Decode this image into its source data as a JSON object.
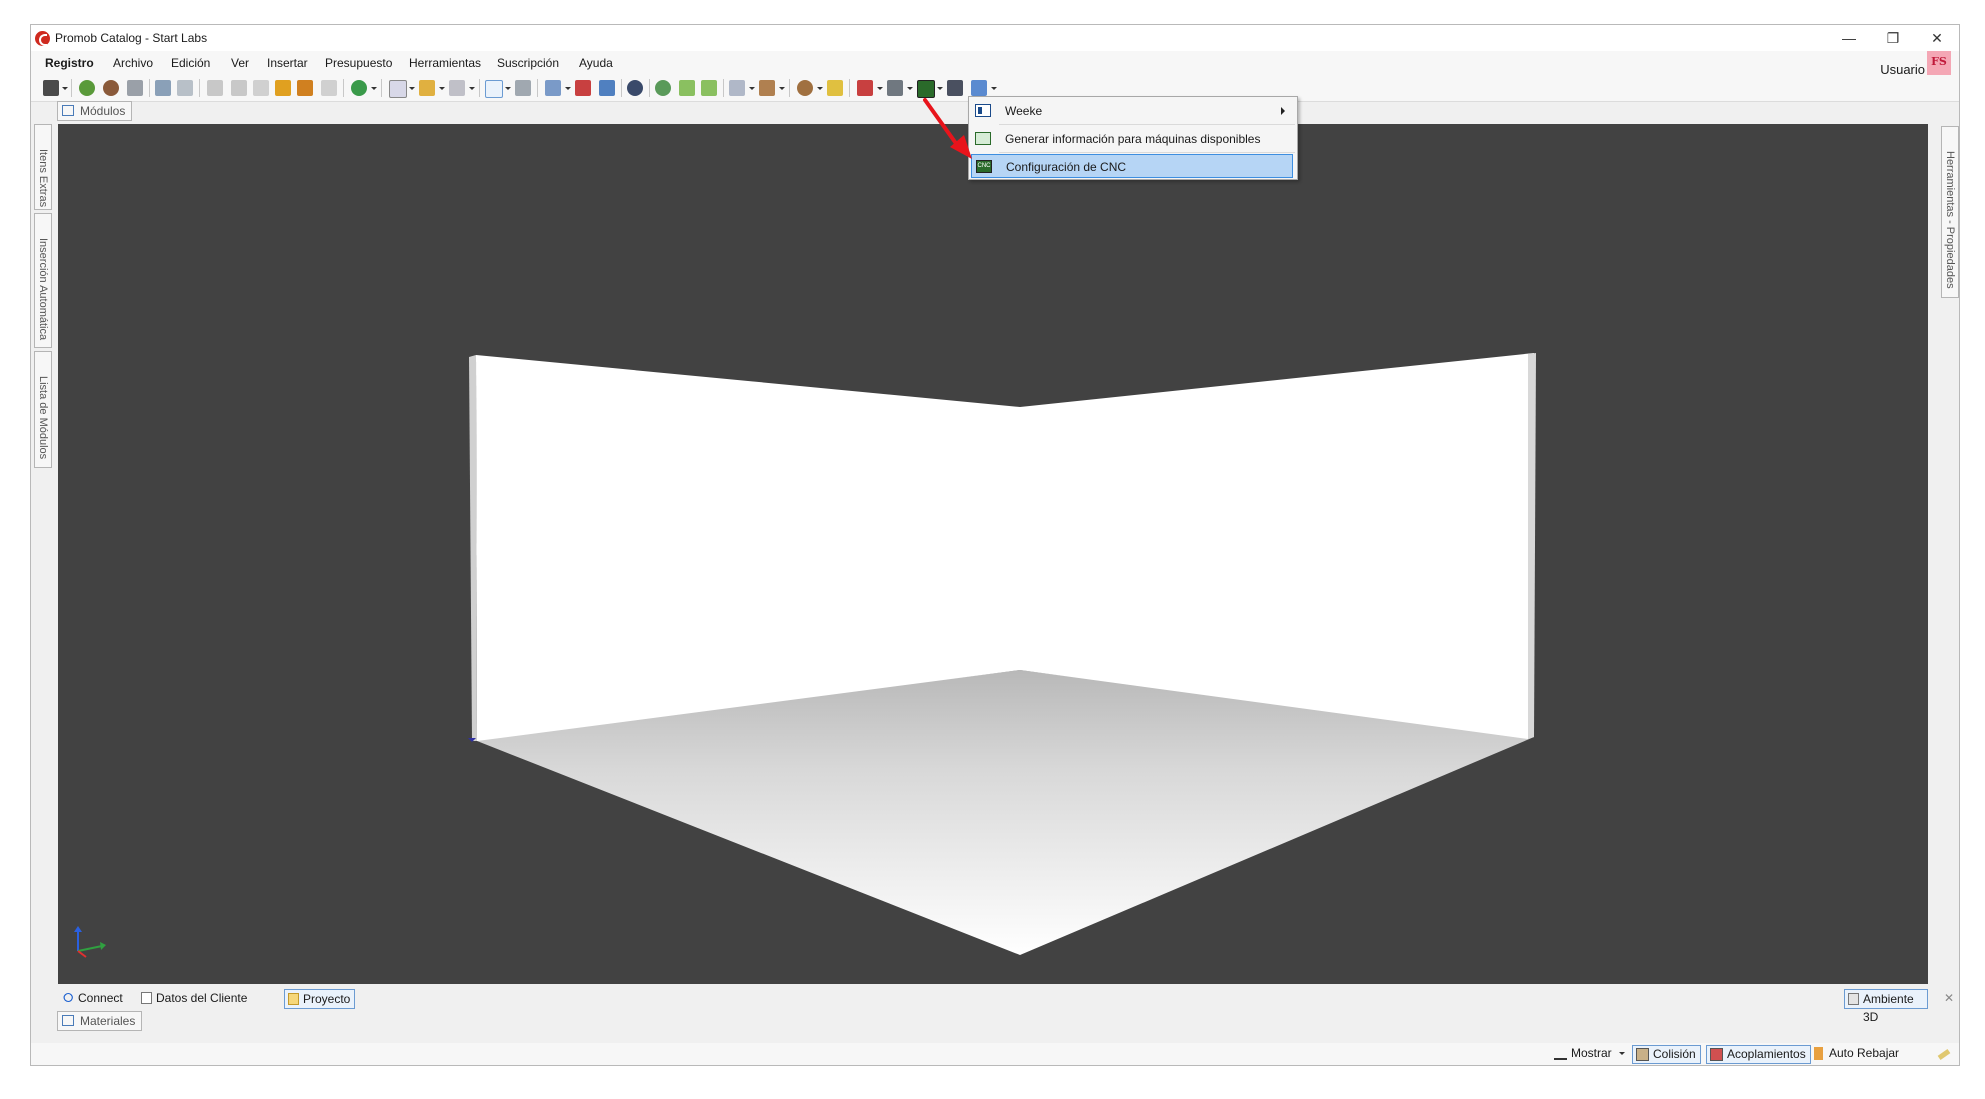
{
  "window": {
    "title": "Promob Catalog - Start Labs",
    "controls": {
      "minimize": "—",
      "restore": "❐",
      "close": "✕"
    }
  },
  "menu": [
    "Registro",
    "Archivo",
    "Edición",
    "Ver",
    "Insertar",
    "Presupuesto",
    "Herramientas",
    "Suscripción",
    "Ayuda"
  ],
  "user": {
    "label": "Usuario",
    "badge": "FS"
  },
  "panels": {
    "top_tab": "Módulos",
    "bottom_tab": "Materiales",
    "left_tabs": [
      "Itens Extras",
      "Inserción Automática",
      "Lista de Módulos"
    ],
    "right_tabs": [
      "Herramientas - Propiedades"
    ]
  },
  "dropdown": {
    "items": [
      {
        "label": "Weeke",
        "icon": "weeke-machine-icon",
        "submenu": true
      },
      {
        "label": "Generar información para máquinas disponibles",
        "icon": "machine-info-icon",
        "submenu": false
      },
      {
        "label": "Configuración de CNC",
        "icon": "cnc-config-icon",
        "submenu": false,
        "highlighted": true
      }
    ]
  },
  "bottom_tabs": [
    {
      "label": "Connect",
      "icon": "rss-icon"
    },
    {
      "label": "Datos del Cliente",
      "icon": "document-icon"
    },
    {
      "label": "Proyecto",
      "icon": "folder-icon",
      "active": true
    }
  ],
  "ambient_tab": {
    "label": "Ambiente 3D",
    "close": "✕"
  },
  "status": {
    "mostrar": "Mostrar",
    "colision": "Colisión",
    "acoplamientos": "Acoplamientos",
    "auto_rebajar": "Auto Rebajar"
  },
  "colors": {
    "viewport": "#424242",
    "highlight": "#b6d5f5",
    "highlight_border": "#3d8ee0",
    "annotation_arrow": "#e8141b"
  }
}
